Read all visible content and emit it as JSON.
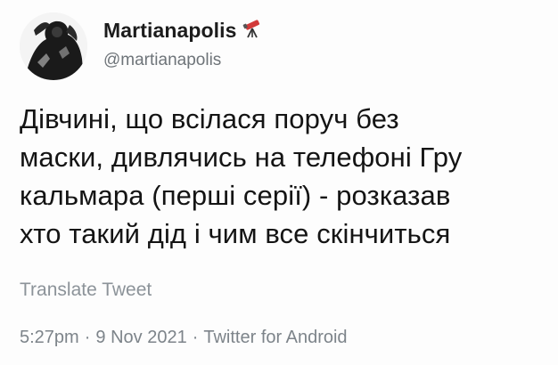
{
  "user": {
    "display_name": "Martianapolis",
    "handle": "@martianapolis",
    "name_emoji": "telescope-icon"
  },
  "tweet": {
    "text": "Дівчині, що всілася поруч без\nмаски, дивлячись на телефоні Гру\nкальмара (перші серії) - розказав\nхто такий дід і чим все скінчиться",
    "translate_label": "Translate Tweet",
    "time": "5:27pm",
    "separator": "·",
    "date": "9 Nov 2021",
    "source": "Twitter for Android"
  },
  "colors": {
    "name": "#1c1c1c",
    "secondary": "#6e7479",
    "telescope_accent": "#d23a3a"
  }
}
